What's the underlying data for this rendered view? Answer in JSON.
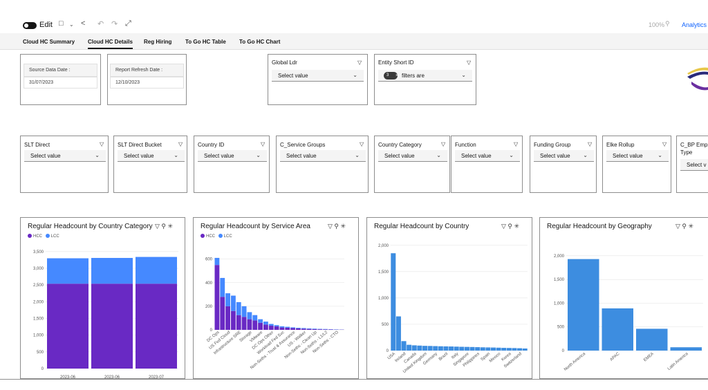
{
  "toolbar": {
    "edit_label": "Edit",
    "zoom": "100%",
    "analytics_label": "Analytics"
  },
  "tabs": [
    {
      "label": "Cloud HC Summary"
    },
    {
      "label": "Cloud HC Details",
      "active": true
    },
    {
      "label": "Reg Hiring"
    },
    {
      "label": "To Go HC Table"
    },
    {
      "label": "To Go HC Chart"
    }
  ],
  "info": {
    "source_label": "Source Data Date :",
    "source_value": "31/07/2023",
    "refresh_label": "Report Refresh Date :",
    "refresh_value": "12/10/2023"
  },
  "filters_top": {
    "global_ldr": {
      "title": "Global Ldr",
      "value": "Select value"
    },
    "entity": {
      "title": "Entity Short ID",
      "tag_count": "3",
      "value": "filters are"
    }
  },
  "filters": [
    {
      "title": "SLT Direct",
      "value": "Select value"
    },
    {
      "title": "SLT Direct Bucket",
      "value": "Select value"
    },
    {
      "title": "Country ID",
      "value": "Select value"
    },
    {
      "title": "C_Service Groups",
      "value": "Select value"
    },
    {
      "title": "Country Category",
      "value": "Select value"
    },
    {
      "title": "Function",
      "value": "Select value"
    },
    {
      "title": "Funding Group",
      "value": "Select value"
    },
    {
      "title": "Elke Rollup",
      "value": "Select value"
    },
    {
      "title": "C_BP Emp",
      "title2": "Type",
      "value": "Select v"
    }
  ],
  "colors": {
    "hcc": "#6929c4",
    "lcc": "#4589ff",
    "bar": "#3d8de0",
    "accent": "#0f62fe"
  },
  "charts": {
    "country_category": {
      "title": "Regular Headcount by Country Category",
      "legend": [
        "HCC",
        "LCC"
      ]
    },
    "service_area": {
      "title": "Regular Headcount by Service Area",
      "legend": [
        "HCC",
        "LCC"
      ]
    },
    "country": {
      "title": "Regular Headcount by Country"
    },
    "geography": {
      "title": "Regular Headcount by Geography"
    }
  },
  "chart_data": [
    {
      "type": "bar",
      "title": "Regular Headcount by Country Category",
      "categories": [
        "2023-06",
        "2023-06",
        "2023-07"
      ],
      "series": [
        {
          "name": "HCC",
          "values": [
            2540,
            2540,
            2540
          ]
        },
        {
          "name": "LCC",
          "values": [
            760,
            770,
            800
          ]
        }
      ],
      "yticks": [
        0,
        500,
        1000,
        1500,
        2000,
        2500,
        3000,
        3500
      ],
      "ylim": [
        0,
        3600
      ]
    },
    {
      "type": "bar",
      "title": "Regular Headcount by Service Area",
      "categories": [
        "DC Ops",
        "",
        "US Fed Cloud",
        "",
        "Infrastructure SRE",
        "",
        "Storage",
        "",
        "VMware",
        "",
        "DC Ops Other",
        "",
        "Workload Fed Svc",
        "",
        "Non-Seths - Trust & Assurance",
        "",
        "US - Walker",
        "",
        "Non-Seths - Clean Up",
        "",
        "Non-Seths - L1/L2",
        "",
        "Non-Seths - CTO",
        ""
      ],
      "series": [
        {
          "name": "HCC",
          "values": [
            550,
            280,
            200,
            160,
            125,
            110,
            90,
            80,
            60,
            45,
            35,
            30,
            20,
            18,
            15,
            12,
            10,
            8,
            6,
            5,
            4,
            3,
            2,
            2
          ]
        },
        {
          "name": "LCC",
          "values": [
            60,
            160,
            110,
            130,
            110,
            90,
            60,
            45,
            30,
            25,
            15,
            10,
            10,
            8,
            6,
            5,
            5,
            4,
            4,
            3,
            3,
            2,
            2,
            1
          ]
        }
      ],
      "yticks": [
        0,
        200,
        400,
        600
      ],
      "ylim": [
        0,
        680
      ]
    },
    {
      "type": "bar",
      "title": "Regular Headcount by Country",
      "categories": [
        "USA",
        "",
        "Ireland",
        "",
        "Canada",
        "",
        "United Kingdom",
        "",
        "Germany",
        "",
        "Brazil",
        "",
        "Italy",
        "",
        "Singapore",
        "",
        "Philippines",
        "",
        "Spain",
        "",
        "Mexico",
        "",
        "Korea",
        "",
        "Switzerland",
        ""
      ],
      "values": [
        1850,
        650,
        180,
        110,
        100,
        95,
        90,
        88,
        85,
        82,
        80,
        78,
        75,
        72,
        70,
        68,
        65,
        62,
        60,
        58,
        55,
        52,
        50,
        48,
        45,
        40
      ],
      "yticks": [
        0,
        500,
        1000,
        1500,
        2000
      ],
      "ylim": [
        0,
        2050
      ]
    },
    {
      "type": "bar",
      "title": "Regular Headcount by Geography",
      "categories": [
        "North America",
        "APAC",
        "EMEA",
        "Latin America"
      ],
      "values": [
        1930,
        890,
        460,
        70
      ],
      "yticks": [
        0,
        500,
        1000,
        1500,
        2000
      ],
      "ylim": [
        0,
        2100
      ]
    }
  ]
}
